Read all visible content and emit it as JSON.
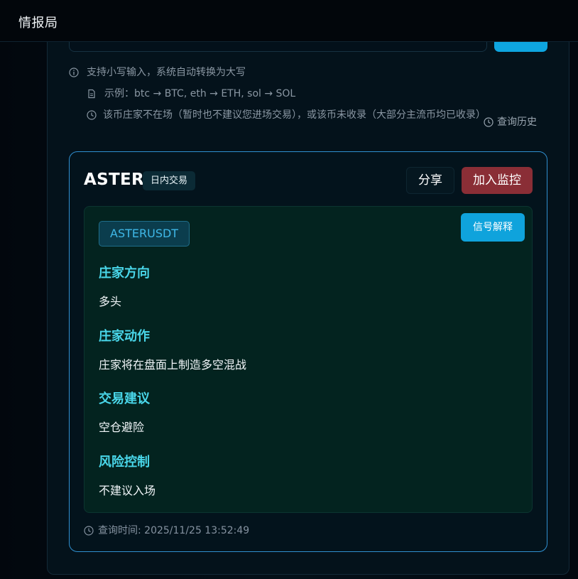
{
  "app": {
    "title": "情报局"
  },
  "hints": {
    "uppercase": "支持小写输入，系统自动转换为大写",
    "example": "示例：btc → BTC, eth → ETH, sol → SOL",
    "notice": "该币庄家不在场（暂时也不建议您进场交易），或该币未收录（大部分主流币均已收录）",
    "history": "查询历史"
  },
  "result": {
    "coin": "ASTER",
    "tag": "日内交易",
    "share_label": "分享",
    "monitor_label": "加入监控",
    "symbol": "ASTERUSDT",
    "explain_label": "信号解释",
    "sections": [
      {
        "heading": "庄家方向",
        "value": "多头"
      },
      {
        "heading": "庄家动作",
        "value": "庄家将在盘面上制造多空混战"
      },
      {
        "heading": "交易建议",
        "value": "空仓避险"
      },
      {
        "heading": "风险控制",
        "value": "不建议入场"
      }
    ],
    "query_time": "查询时间: 2025/11/25 13:52:49"
  },
  "colors": {
    "accent": "#0fa3dc",
    "danger": "#8a2e36",
    "heading": "#49d6e9",
    "card_border": "#2f8fd0"
  }
}
